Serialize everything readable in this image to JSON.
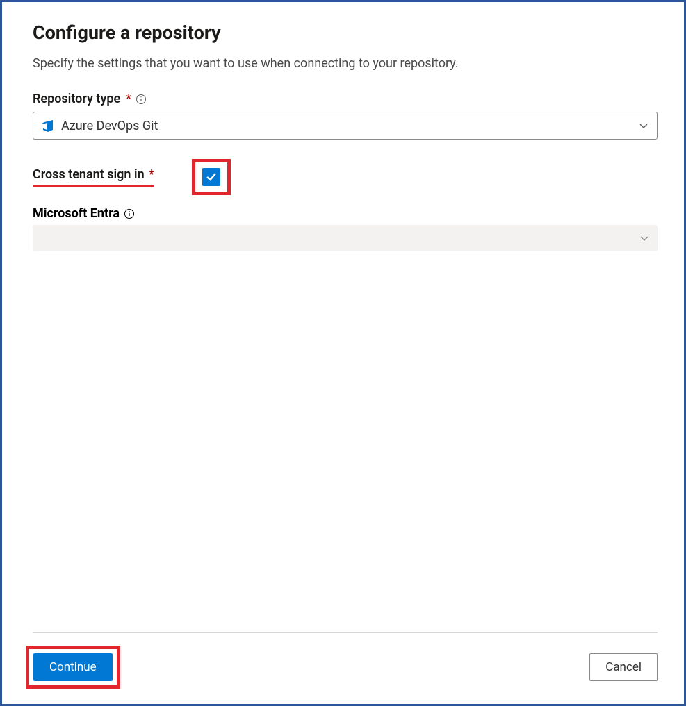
{
  "header": {
    "title": "Configure a repository",
    "subtitle": "Specify the settings that you want to use when connecting to your repository."
  },
  "repoType": {
    "label": "Repository type",
    "required_marker": "*",
    "value": "Azure DevOps Git"
  },
  "crossTenant": {
    "label": "Cross tenant sign in",
    "required_marker": "*",
    "checked": true
  },
  "entra": {
    "label": "Microsoft Entra",
    "value": ""
  },
  "footer": {
    "continue_label": "Continue",
    "cancel_label": "Cancel"
  },
  "colors": {
    "primary": "#0078d4",
    "highlight": "#e3262d",
    "frame": "#2b579a"
  }
}
